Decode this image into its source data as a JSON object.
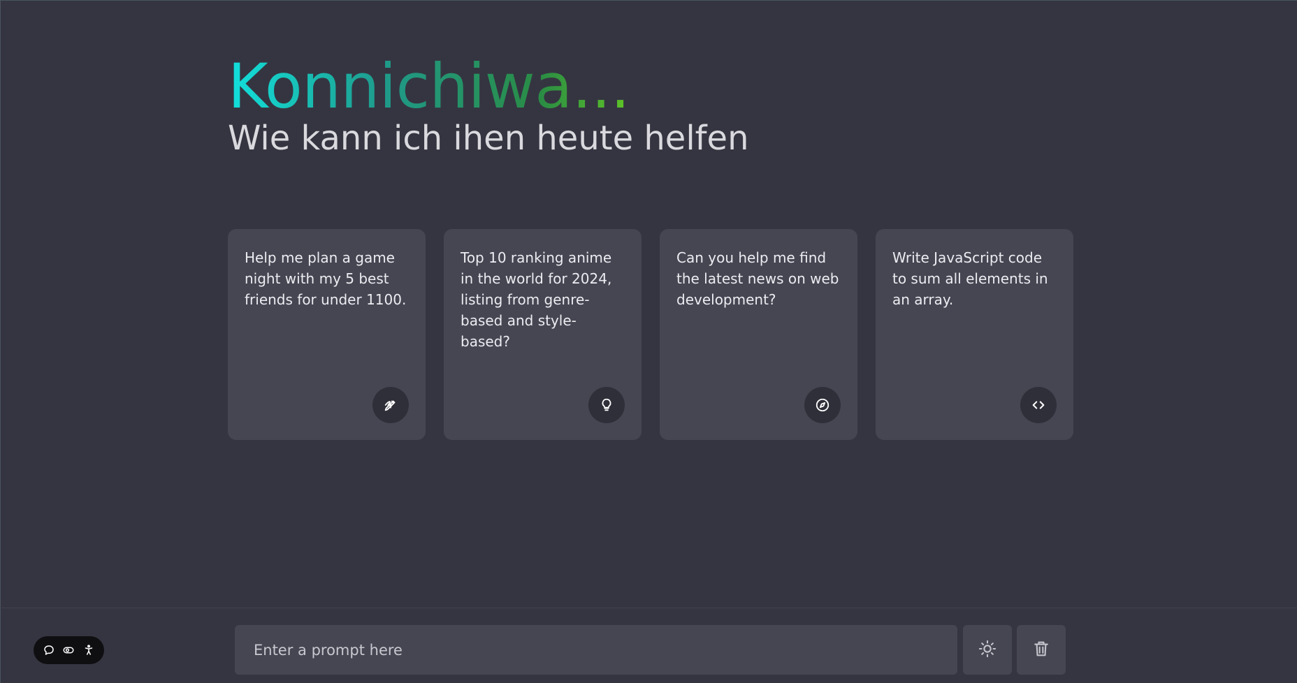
{
  "header": {
    "greeting": "Konnichiwa...",
    "subtitle": "Wie kann ich ihen heute helfen"
  },
  "cards": [
    {
      "text": "Help me plan a game night with my 5 best friends for under 1100.",
      "icon": "draw-icon"
    },
    {
      "text": "Top 10 ranking anime in the world for 2024, listing from genre-based and style-based?",
      "icon": "lightbulb-icon"
    },
    {
      "text": "Can you help me find the latest news on web development?",
      "icon": "compass-icon"
    },
    {
      "text": "Write JavaScript code to sum all elements in an array.",
      "icon": "code-icon"
    }
  ],
  "prompt": {
    "placeholder": "Enter a prompt here",
    "value": ""
  },
  "actions": [
    {
      "name": "theme-toggle-button",
      "icon": "sun-icon"
    },
    {
      "name": "delete-chats-button",
      "icon": "trash-icon"
    }
  ],
  "accessibility_widget": {
    "icons": [
      "chat-bubble-icon",
      "toggle-icon",
      "accessibility-person-icon"
    ]
  },
  "colors": {
    "background": "#353541",
    "card": "#454652",
    "icon_circle": "#2f2f39",
    "gradient_start": "#12e0dc",
    "gradient_end": "#b9f20a",
    "subtitle": "#d9d9de"
  }
}
